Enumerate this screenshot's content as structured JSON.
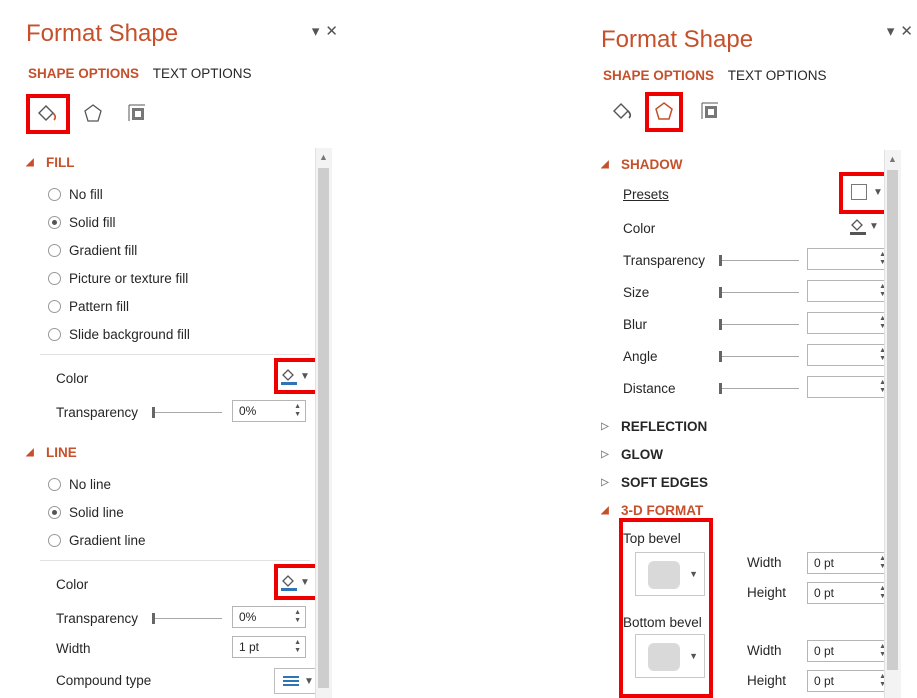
{
  "left": {
    "title": "Format Shape",
    "title_controls": "▾ ✕",
    "tabs": [
      "SHAPE OPTIONS",
      "TEXT OPTIONS"
    ],
    "fill": {
      "header": "FILL",
      "options": [
        "No fill",
        "Solid fill",
        "Gradient fill",
        "Picture or texture fill",
        "Pattern fill",
        "Slide background fill"
      ],
      "selected": "Solid fill",
      "color_label": "Color",
      "transparency_label": "Transparency",
      "transparency_value": "0%"
    },
    "line": {
      "header": "LINE",
      "options": [
        "No line",
        "Solid line",
        "Gradient line"
      ],
      "selected": "Solid line",
      "color_label": "Color",
      "transparency_label": "Transparency",
      "transparency_value": "0%",
      "width_label": "Width",
      "width_value": "1 pt",
      "compound_label": "Compound type"
    }
  },
  "right": {
    "title": "Format Shape",
    "title_controls": "▾ ✕",
    "tabs": [
      "SHAPE OPTIONS",
      "TEXT OPTIONS"
    ],
    "shadow": {
      "header": "SHADOW",
      "presets_label": "Presets",
      "color_label": "Color",
      "transparency_label": "Transparency",
      "size_label": "Size",
      "blur_label": "Blur",
      "angle_label": "Angle",
      "distance_label": "Distance"
    },
    "reflection_header": "REFLECTION",
    "glow_header": "GLOW",
    "soft_edges_header": "SOFT EDGES",
    "format3d": {
      "header": "3-D FORMAT",
      "top_bevel_label": "Top bevel",
      "bottom_bevel_label": "Bottom bevel",
      "top_width_label": "Width",
      "top_width_value": "0 pt",
      "top_height_label": "Height",
      "top_height_value": "0 pt",
      "bottom_width_label": "Width",
      "bottom_width_value": "0 pt",
      "bottom_height_label": "Height",
      "bottom_height_value": "0 pt"
    }
  },
  "colors": {
    "accent": "#c5502b",
    "highlight_box": "#ee0000",
    "color_swatch": "#2e75b6"
  },
  "icons": [
    "fill-line-icon",
    "effects-icon",
    "size-properties-icon",
    "paint-bucket-icon",
    "preset-square-icon",
    "dropdown-arrow-icon"
  ]
}
